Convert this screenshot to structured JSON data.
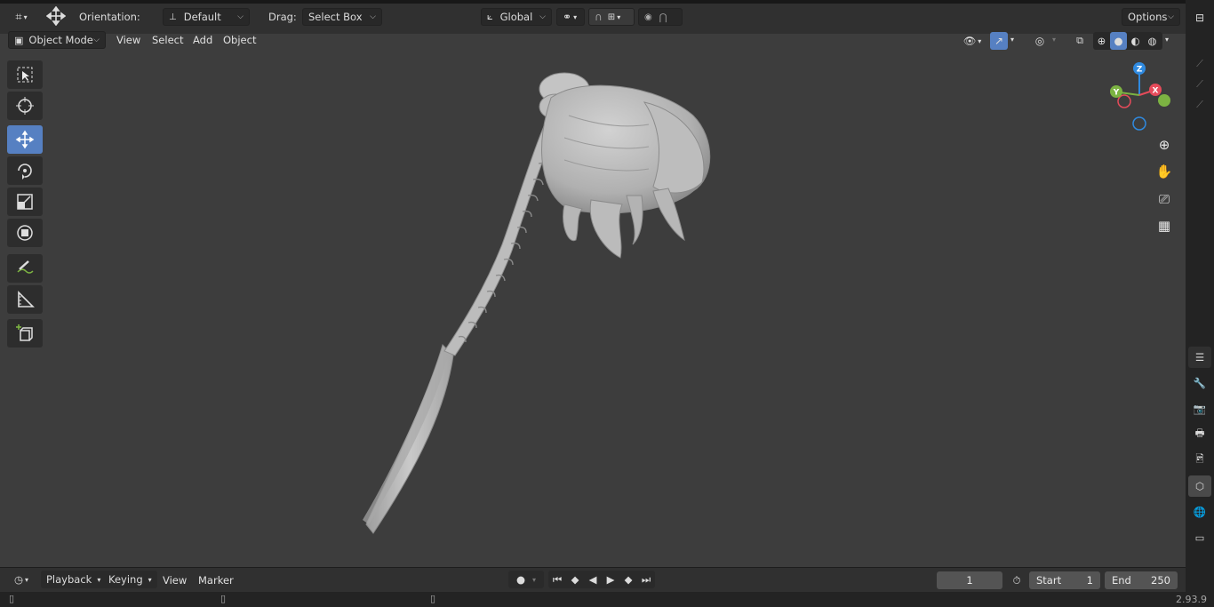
{
  "header": {
    "orientation_label": "Orientation:",
    "orientation_value": "Default",
    "drag_label": "Drag:",
    "drag_value": "Select Box",
    "transform_space": "Global",
    "options_label": "Options"
  },
  "viewport_header": {
    "mode": "Object Mode",
    "menus": [
      "View",
      "Select",
      "Add",
      "Object"
    ]
  },
  "gizmo": {
    "z": "Z",
    "y": "Y",
    "x": "X"
  },
  "timeline": {
    "menus": [
      "Playback",
      "Keying",
      "View",
      "Marker"
    ],
    "current_frame": "1",
    "start_label": "Start",
    "start_value": "1",
    "end_label": "End",
    "end_value": "250"
  },
  "status": {
    "version": "2.93.9"
  },
  "colors": {
    "accent": "#5680c2",
    "gizmo_x": "#e64b5a",
    "gizmo_y": "#7cb342",
    "gizmo_z": "#2f8ae0",
    "mesh": "#b8b8b8",
    "viewport_bg": "#3d3d3d"
  }
}
